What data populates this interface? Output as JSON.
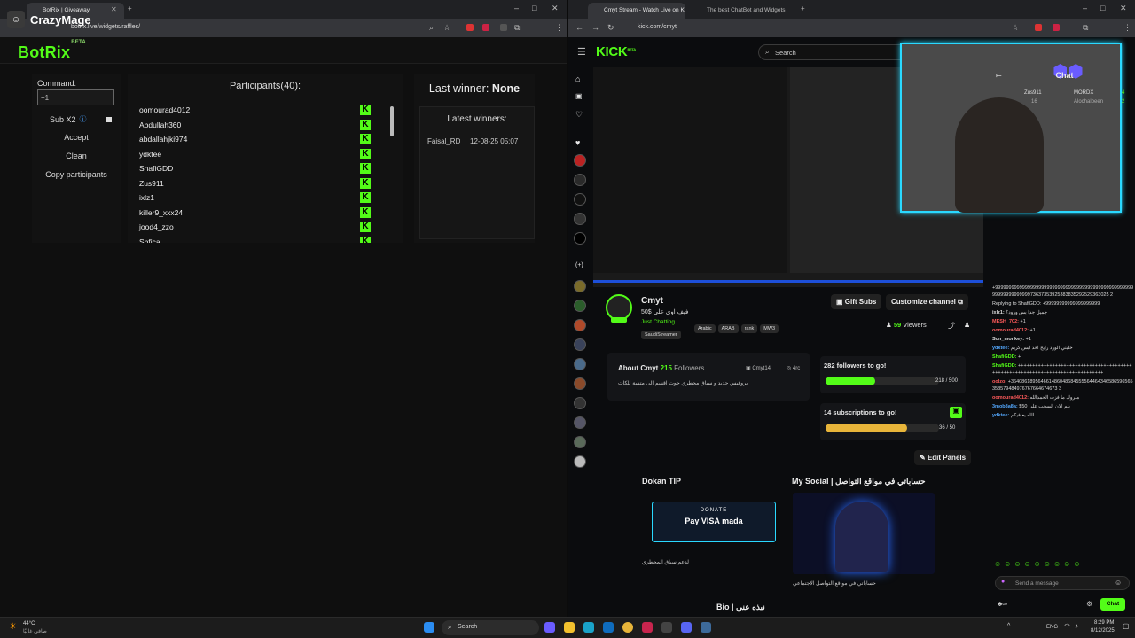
{
  "overlay_label": "CrazyMage",
  "left_window": {
    "tab_title": "BotRix | Giveaway",
    "url": "botrix.live/widgets/raffles/",
    "app": {
      "logo": "BotRix",
      "logo_badge": "BETA",
      "command_label": "Command:",
      "command_value": "+1",
      "sub_multiplier_label": "Sub X2",
      "info_icon": "info-icon",
      "accept_label": "Accept",
      "clean_label": "Clean",
      "copy_label": "Copy participants",
      "participants_title": "Participants(40):",
      "participants": [
        "oomourad4012",
        "Abdullah360",
        "abdallahjki974",
        "ydktee",
        "ShafiGDD",
        "Zus911",
        "ixlz1",
        "killer9_xxx24",
        "jood4_zzo",
        "Sbfica"
      ],
      "platform_badge": "K",
      "last_winner_label": "Last winner:",
      "last_winner_value": "None",
      "latest_winners_title": "Latest winners:",
      "latest_winners": [
        {
          "name": "Faisal_RD",
          "time": "12-08-25 05:07"
        }
      ]
    }
  },
  "right_window": {
    "tabs": [
      "Cmyt Stream - Watch Live on K",
      "The best ChatBot and Widgets"
    ],
    "url": "kick.com/cmyt",
    "logo": "KICK",
    "logo_badge": "BETA",
    "search_placeholder": "Search",
    "chat_title": "Chat",
    "top_chatters": [
      {
        "name": "Zus911",
        "count": "16"
      },
      {
        "name": "MORDX",
        "count": "4"
      },
      {
        "name": "Alochalbeen",
        "count": "2"
      }
    ],
    "channel": {
      "name": "Cmyt",
      "subtitle": "50$ فيف اوي علي",
      "category": "Just Chatting",
      "tags": [
        "Arabic",
        "ARAB",
        "rank",
        "MW3",
        "SaudiStreamer"
      ],
      "viewers": "59",
      "viewers_label": "Viewers",
      "gift_subs": "Gift Subs",
      "customize": "Customize channel"
    },
    "about": {
      "title": "About Cmyt",
      "followers": "215",
      "followers_label": "Followers",
      "socials": [
        "Cmyt14",
        "4rc"
      ],
      "text": "بروفيس جديد و سباق محطري جوت اقسم الى متسة للكات"
    },
    "goals": [
      {
        "title": "282 followers to go!",
        "progress": "218 / 500",
        "fraction": 0.436,
        "color": "#53fc18"
      },
      {
        "title": "14 subscriptions to go!",
        "progress": "36 / 50",
        "fraction": 0.72,
        "color": "#e8b53a"
      }
    ],
    "edit_panels": "Edit Panels",
    "panels": [
      {
        "title": "Dokan TIP",
        "caption": "لدعم سباق المحطري",
        "donate": "DONATE",
        "pay": "Pay  VISA  mada"
      },
      {
        "title": "My Social | حساباتي في مواقع التواصل",
        "caption": "حساباتي في مواقع التواصل الاجتماعي"
      }
    ],
    "bio_title": "Bio | نبذه عني",
    "chat_messages": [
      {
        "user": "",
        "text": "+9999999999999999999999999999999999999999999999999999999999999999973637353925383835292529363025 2"
      },
      {
        "user": "",
        "text": "Replying to ShafiGDD: +99999999999999999999"
      },
      {
        "user": "ixlz1:",
        "text": "جميل جدا بس ورود؟",
        "color": "#ddd"
      },
      {
        "user": "MESH_702:",
        "text": "+1",
        "color": "#ff5a5a"
      },
      {
        "user": "oomourad4012:",
        "text": "+1",
        "color": "#ff5a5a"
      },
      {
        "user": "Son_monkey:",
        "text": "+1",
        "color": "#ddd"
      },
      {
        "user": "ydktee:",
        "text": "خليني الورد رايح اخذ ايس كريم",
        "color": "#53a7fc"
      },
      {
        "user": "ShafiGDD:",
        "text": "+",
        "color": "#53fc18"
      },
      {
        "user": "ShafiGDD:",
        "text": "+++++++++++++++++++++++++++++++++++++++++++++++++++++++++++++++++++++++++++++++",
        "color": "#53fc18"
      },
      {
        "user": "oolzo:",
        "text": "+364086189564661486048684555564464346586596565358579484976767664674673 3",
        "color": "#ff5a5a"
      },
      {
        "user": "oomourad4012:",
        "text": "مبروك ما فزت الحمدالله",
        "color": "#ff5a5a"
      },
      {
        "user": "3mob8a8a:",
        "text": "$50 يتم الان السحب على",
        "color": "#53a7fc"
      },
      {
        "user": "ydktee:",
        "text": "الله يعافيكم",
        "color": "#53a7fc"
      }
    ],
    "chat_input_placeholder": "Send a message",
    "chat_button": "Chat"
  },
  "taskbar": {
    "weather_temp": "44°C",
    "weather_text": "صافي غالبًا",
    "search_label": "Search",
    "lang": "ENG",
    "time": "8:29 PM",
    "date": "8/12/2025"
  }
}
